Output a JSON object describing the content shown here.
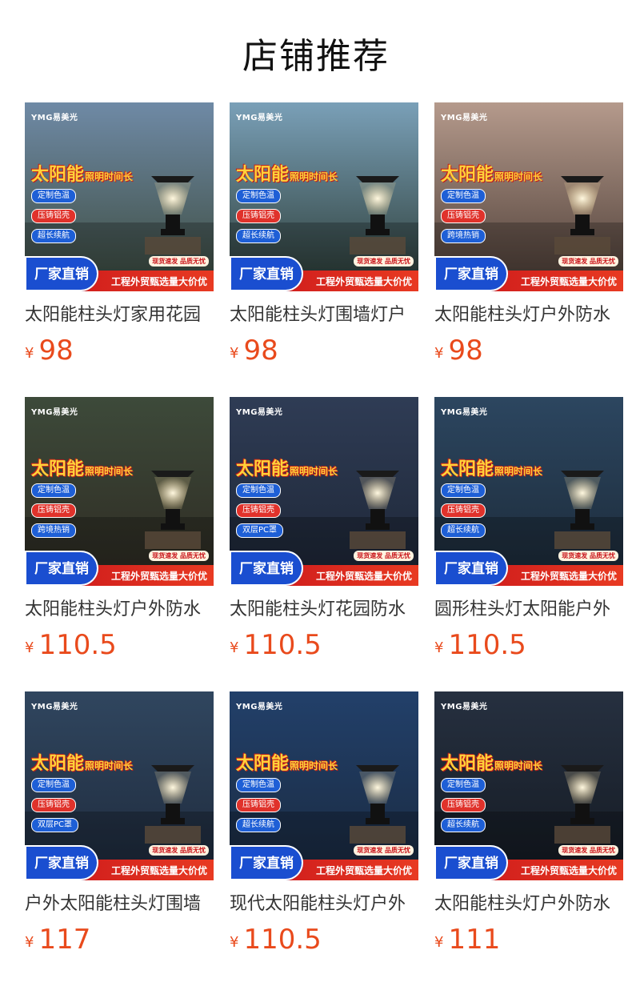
{
  "section_title": "店铺推荐",
  "badges": {
    "brand": "YMG易美光",
    "headline_main": "太阳能",
    "headline_sub": "照明时间长",
    "factory": "厂家直销",
    "bar_text": "工程外贸甄选量大价优",
    "mini": "现货速发 品质无忧"
  },
  "currency": "¥",
  "products": [
    {
      "name": "太阳能柱头灯家用花园",
      "price": "98",
      "tags": [
        "定制色温",
        "压铸铝壳",
        "超长续航"
      ],
      "bg": "#3b4a3c",
      "sky": "#6f8aa6"
    },
    {
      "name": "太阳能柱头灯围墙灯户",
      "price": "98",
      "tags": [
        "定制色温",
        "压铸铝壳",
        "超长续航"
      ],
      "bg": "#2a3a33",
      "sky": "#7aa0b8"
    },
    {
      "name": "太阳能柱头灯户外防水",
      "price": "98",
      "tags": [
        "定制色温",
        "压铸铝壳",
        "跨境热销"
      ],
      "bg": "#4a3b34",
      "sky": "#b59a8c"
    },
    {
      "name": "太阳能柱头灯户外防水",
      "price": "110.5",
      "tags": [
        "定制色温",
        "压铸铝壳",
        "跨境热销"
      ],
      "bg": "#2e2a22",
      "sky": "#3d4a3a"
    },
    {
      "name": "太阳能柱头灯花园防水",
      "price": "110.5",
      "tags": [
        "定制色温",
        "压铸铝壳",
        "双层PC罩"
      ],
      "bg": "#1d2636",
      "sky": "#2f3c55"
    },
    {
      "name": "圆形柱头灯太阳能户外",
      "price": "110.5",
      "tags": [
        "定制色温",
        "压铸铝壳",
        "超长续航"
      ],
      "bg": "#1c2a38",
      "sky": "#2c4660"
    },
    {
      "name": "户外太阳能柱头灯围墙",
      "price": "117",
      "tags": [
        "定制色温",
        "压铸铝壳",
        "双层PC罩"
      ],
      "bg": "#1e2a3c",
      "sky": "#30465f"
    },
    {
      "name": "现代太阳能柱头灯户外",
      "price": "110.5",
      "tags": [
        "定制色温",
        "压铸铝壳",
        "超长续航"
      ],
      "bg": "#1a2a40",
      "sky": "#22406a"
    },
    {
      "name": "太阳能柱头灯户外防水",
      "price": "111",
      "tags": [
        "定制色温",
        "压铸铝壳",
        "超长续航"
      ],
      "bg": "#141a22",
      "sky": "#263040"
    }
  ]
}
